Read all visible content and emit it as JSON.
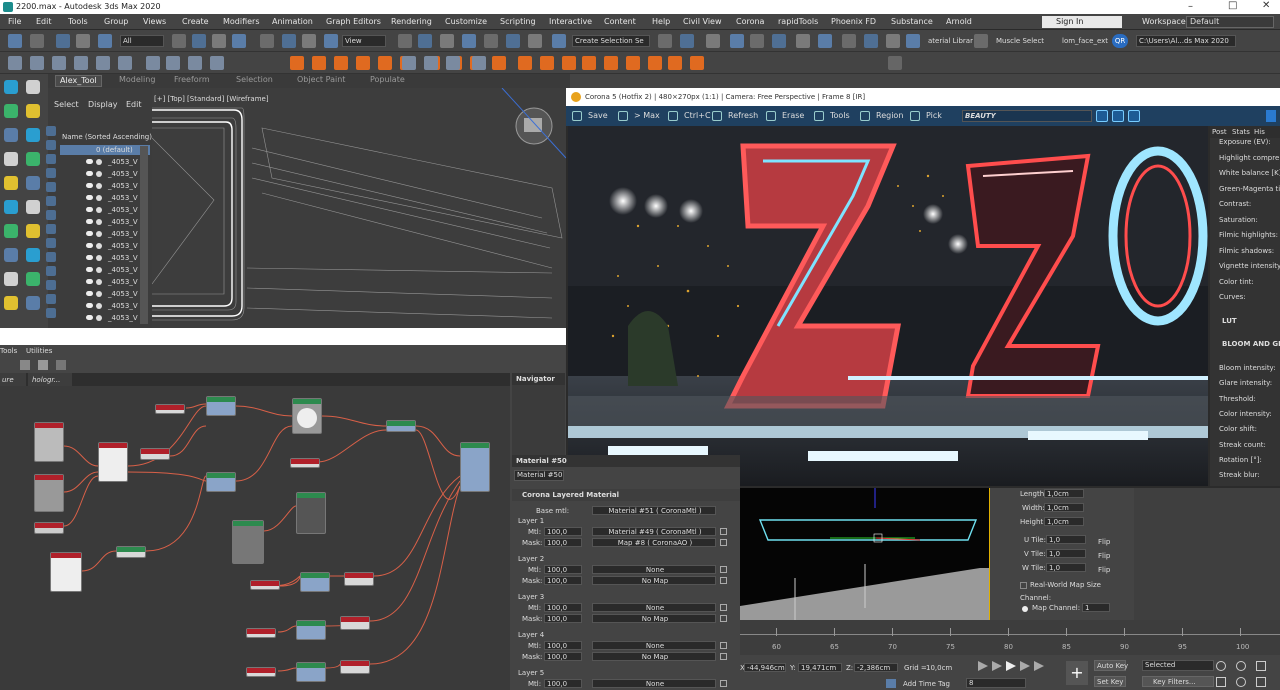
{
  "app": {
    "title": "2200.max - Autodesk 3ds Max 2020"
  },
  "menu": [
    "File",
    "Edit",
    "Tools",
    "Group",
    "Views",
    "Create",
    "Modifiers",
    "Animation",
    "Graph Editors",
    "Rendering",
    "Customize",
    "Scripting",
    "Interactive",
    "Content",
    "Help",
    "Civil View",
    "Corona",
    "rapidTools",
    "Phoenix FD",
    "Substance",
    "Arnold"
  ],
  "account": {
    "sign_in": "Sign In",
    "workspaces_label": "Workspaces:",
    "workspace": "Default"
  },
  "toolbar": {
    "filter": "All",
    "view": "View",
    "selection_set": "Create Selection Se",
    "material_library": "aterial Librar",
    "muscle_select": "Muscle Select",
    "script": "lom_face_ext",
    "path": "C:\\Users\\Al...ds Max 2020"
  },
  "ribbon_tabs": [
    "Alex_Tool",
    "Modeling",
    "Freeform",
    "Selection",
    "Object Paint",
    "Populate"
  ],
  "scene_explorer": {
    "tabs": [
      "Select",
      "Display",
      "Edit"
    ],
    "header": "Name (Sorted Ascending)",
    "layer": "0 (default)",
    "items": [
      "_4053_V",
      "_4053_V",
      "_4053_V",
      "_4053_V",
      "_4053_V",
      "_4053_V",
      "_4053_V",
      "_4053_V",
      "_4053_V",
      "_4053_V",
      "_4053_V",
      "_4053_V",
      "_4053_V",
      "_4053_V"
    ]
  },
  "viewport": {
    "label": "[+] [Top] [Standard] [Wireframe]"
  },
  "render": {
    "title": "Corona 5 (Hotfix 2) | 480×270px (1:1) | Camera: Free Perspective | Frame 8 [IR]",
    "buttons": [
      "Save",
      "> Max",
      "Ctrl+C",
      "Refresh",
      "Erase",
      "Tools",
      "Region",
      "Pick"
    ],
    "channel": "BEAUTY",
    "post_tabs": [
      "Post",
      "Stats",
      "His"
    ],
    "post_items": [
      "Exposure (EV):",
      "Highlight compre",
      "White balance [K]",
      "Green-Magenta ti",
      "Contrast:",
      "Saturation:",
      "Filmic highlights:",
      "Filmic shadows:",
      "Vignette intensity",
      "Color tint:",
      "Curves:"
    ],
    "lut": "LUT",
    "bloom_header": "BLOOM AND GL",
    "bloom_items": [
      "Bloom intensity:",
      "Glare intensity:",
      "Threshold:",
      "Color intensity:",
      "Color shift:",
      "Streak count:",
      "Rotation [°]:",
      "Streak blur:"
    ]
  },
  "sme": {
    "tabs": [
      "Tools",
      "Utilities"
    ],
    "view_tabs": [
      "ure",
      "hologr..."
    ],
    "navigator": "Navigator",
    "material_header": "Material #50",
    "material_name": "Material #50"
  },
  "material": {
    "title": "Corona Layered Material",
    "base_label": "Base mtl:",
    "base_value": "Material #51  ( CoronaMtl )",
    "layers": [
      {
        "name": "Layer 1",
        "mtl_amt": "100,0",
        "mtl": "Material #49  ( CoronaMtl )",
        "mask_amt": "100,0",
        "mask": "Map #8  ( CoronaAO )"
      },
      {
        "name": "Layer 2",
        "mtl_amt": "100,0",
        "mtl": "None",
        "mask_amt": "100,0",
        "mask": "No Map"
      },
      {
        "name": "Layer 3",
        "mtl_amt": "100,0",
        "mtl": "None",
        "mask_amt": "100,0",
        "mask": "No Map"
      },
      {
        "name": "Layer 4",
        "mtl_amt": "100,0",
        "mtl": "None",
        "mask_amt": "100,0",
        "mask": "No Map"
      },
      {
        "name": "Layer 5",
        "mtl_amt": "100,0",
        "mtl": "None",
        "mask_amt": "",
        "mask": ""
      }
    ],
    "mtl_label": "Mtl:",
    "mask_label": "Mask:"
  },
  "mapping": {
    "length_label": "Length:",
    "length": "1,0cm",
    "width_label": "Width:",
    "width": "1,0cm",
    "height_label": "Height:",
    "height": "1,0cm",
    "u_tile_label": "U Tile:",
    "u_tile": "1,0",
    "v_tile_label": "V Tile:",
    "v_tile": "1,0",
    "w_tile_label": "W Tile:",
    "w_tile": "1,0",
    "flip": "Flip",
    "real_world": "Real-World Map Size",
    "channel_label": "Channel:",
    "map_channel_label": "Map Channel:",
    "map_channel": "1"
  },
  "timeline": {
    "ticks": [
      "60",
      "65",
      "70",
      "75",
      "80",
      "85",
      "90",
      "95",
      "100"
    ]
  },
  "status": {
    "x_label": "X:",
    "x": "-44,946cm",
    "y_label": "Y:",
    "y": "19,471cm",
    "z_label": "Z:",
    "z": "-2,386cm",
    "grid_label": "Grid =",
    "grid": "10,0cm",
    "add_time_tag": "Add Time Tag",
    "frame": "8",
    "auto_key": "Auto Key",
    "selected": "Selected",
    "set_key": "Set Key",
    "key_filters": "Key Filters..."
  },
  "colors": {
    "accent": "#1f6fb0",
    "neon_red": "#ff4d4d",
    "neon_cyan": "#7fe3ff",
    "node_green": "#2d8a4e",
    "node_red": "#b0202a"
  }
}
